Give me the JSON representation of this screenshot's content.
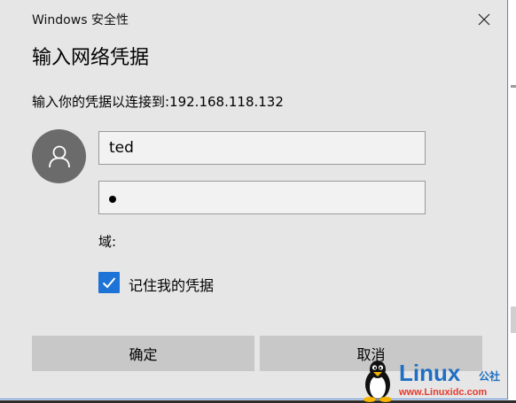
{
  "window": {
    "title": "Windows 安全性",
    "close_icon": "close-icon"
  },
  "dialog": {
    "heading": "输入网络凭据",
    "subtext": "输入你的凭据以连接到:192.168.118.132"
  },
  "fields": {
    "username_value": "ted",
    "password_masked": "•",
    "domain_label": "域:"
  },
  "remember": {
    "label": "记住我的凭据",
    "checked": true
  },
  "buttons": {
    "ok_label": "确定",
    "cancel_label": "取消"
  },
  "watermark": {
    "brand": "Linux",
    "suffix": "公社",
    "url": "www.Linuxidc.com"
  },
  "colors": {
    "accent": "#1e73d6",
    "dialog_bg": "#e6e6e6",
    "button_bg": "#c8c8c8",
    "avatar_bg": "#6b6b6b"
  }
}
